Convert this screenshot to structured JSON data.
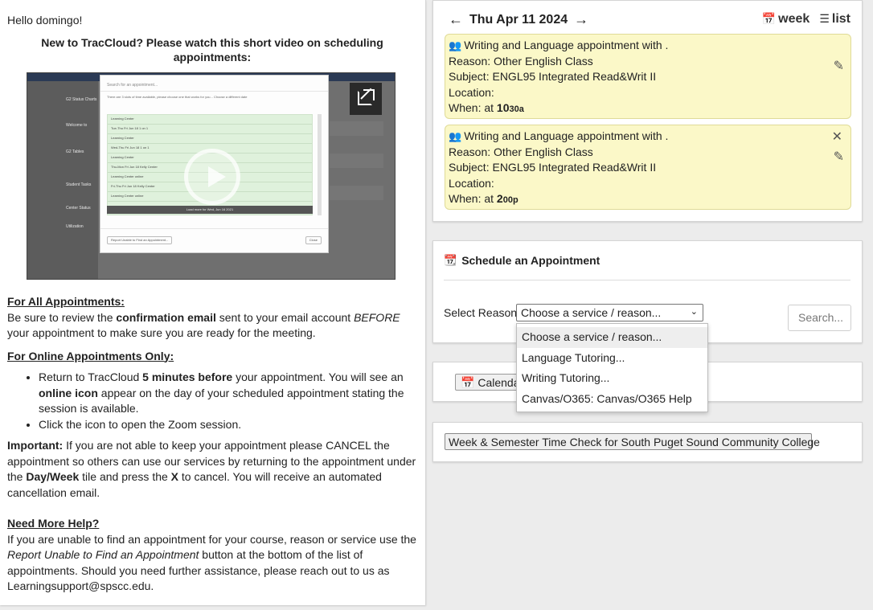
{
  "left": {
    "greeting": "Hello domingo!",
    "intro": "New to TracCloud? Please watch this short video on scheduling appointments:",
    "video": {
      "modal_search_placeholder": "Search for an appointment...",
      "modal_note": "There are 3 slots of time available, please choose one that works for you... Choose a different date",
      "rows": [
        "Learning Center",
        "Tue-Thu   Fri Jun 18 1 on 1",
        "Learning Center",
        "Wed-Thu   Fri Jun 18 1 on 1",
        "Learning Center",
        "Thu-Mon   Fri Jun 18 Kelly Center",
        "Learning Center   online",
        "Fri-Thu   Fri Jun 18 Kelly Center",
        "Learning Center   online"
      ],
      "bar_text": "Load more for Wed, Jun 16 2021",
      "footer_left": "Report Unable to Find an Appointment...",
      "footer_right": "Close",
      "nav_items": [
        "G2 Status Charts",
        "Welcome to",
        "G2 Tables",
        "Student Tasks",
        "Center Status",
        "Utilization"
      ]
    },
    "section1_heading": "For All Appointments:",
    "section1_text_a": "Be sure to review the ",
    "section1_bold": "confirmation email",
    "section1_text_b": " sent to your email account ",
    "section1_italic": "BEFORE",
    "section1_text_c": " your appointment to make sure you are ready for the meeting.",
    "section2_heading": "For Online Appointments Only:",
    "bullet1_a": "Return to TracCloud ",
    "bullet1_bold1": "5 minutes before",
    "bullet1_b": " your appointment. You will see an ",
    "bullet1_bold2": "online icon",
    "bullet1_c": " appear on the day of your scheduled appointment stating the session is available.",
    "bullet2": "Click the icon to open the Zoom session.",
    "important_label": "Important:",
    "important_a": " If you are not able to keep your appointment please CANCEL the appointment so others can use our services by returning to the appointment under the ",
    "important_bold1": "Day/Week",
    "important_b": " tile and press the ",
    "important_bold2": "X",
    "important_c": " to cancel. You will receive an automated cancellation email.",
    "help_heading": "Need More Help?",
    "help_a": "If you are unable to find an appointment for your course, reason or service use the ",
    "help_italic": "Report Unable to Find an Appointment",
    "help_b": " button at the bottom of the list of appointments. Should you need further assistance, please reach out to us as Learningsupport@spscc.edu."
  },
  "day": {
    "date": "Thu Apr 11 2024",
    "view_week": "week",
    "view_list": "list",
    "appointments": [
      {
        "title": "Writing and Language appointment with .",
        "reason": "Reason: Other English Class",
        "subject": "Subject: ENGL95 Integrated Read&Writ II",
        "location": "Location:",
        "when_label": "When: at ",
        "time_main": "10",
        "time_suffix": "30a"
      },
      {
        "title": "Writing and Language appointment with .",
        "reason": "Reason: Other English Class",
        "subject": "Subject: ENGL95 Integrated Read&Writ II",
        "location": "Location:",
        "when_label": "When: at ",
        "time_main": "2",
        "time_suffix": "00p"
      }
    ]
  },
  "schedule": {
    "title": "Schedule an Appointment",
    "reason_label": "Select Reason",
    "selected": "Choose a service / reason...",
    "search_placeholder": "Search...",
    "options": [
      "Choose a service / reason...",
      "Language Tutoring...",
      "Writing Tutoring...",
      "Canvas/O365: Canvas/O365 Help"
    ]
  },
  "calendar_button": "Calendar",
  "week_check_button": "Week & Semester Time Check for South Puget Sound Community College",
  "colors": {
    "appointment_bg": "#fbf8c8",
    "appointment_border": "#dfdb98",
    "page_bg": "#ececec"
  }
}
